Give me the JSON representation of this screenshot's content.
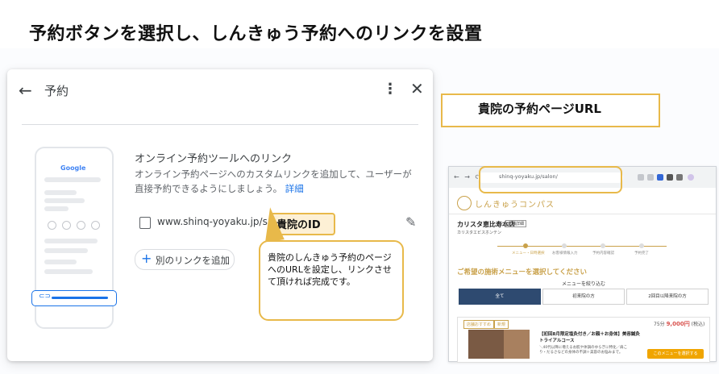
{
  "slide": {
    "title": "予約ボタンを選択し、しんきゅう予約へのリンクを設置"
  },
  "dialog": {
    "title": "予約",
    "back_icon": "arrow-back-icon",
    "more_icon": "more-vert-icon",
    "close_icon": "close-icon",
    "heading": "オンライン予約ツールへのリンク",
    "description": "オンライン予約ページへのカスタムリンクを追加して、ユーザーが直接予約できるようにしましょう。",
    "details_link": "詳細",
    "url": "www.shinq-yoyaku.jp/salon/",
    "id_label": "貴院のID",
    "add_link_label": "別のリンクを追加",
    "phone_logo": "Google"
  },
  "callout": {
    "text": "貴院のしんきゅう予約のページへのURLを設定し、リンクさせて頂ければ完成です。"
  },
  "right_label": {
    "text": "貴院の予約ページURL"
  },
  "browser": {
    "address": "shinq-yoyaku.jp/salon/",
    "brand": "しんきゅうコンパス",
    "salon_name": "カリスタ恵比寿本店",
    "salon_kana": "カリスタエビスホンテン",
    "badge": "店舗詳細",
    "steps": [
      "メニュー・日時選択",
      "お客様情報入力",
      "予約内容確認",
      "予約完了"
    ],
    "section_title": "ご希望の施術メニューを選択してください",
    "filter_label": "メニューを絞り込む",
    "tabs": [
      "全て",
      "初来院の方",
      "2回目以降来院の方"
    ],
    "tags": [
      "店舗おすすめ",
      "新規"
    ],
    "course_title": "【初回8月限定塩灸付き／お顔＋お身体】美容鍼灸トライアルコース",
    "course_desc": "＼40代以降に増えるお肌や体調のゆらぎに特化／肩こり・だるさなどの身体の不調＋美容のお悩みまで。",
    "duration": "75分",
    "price": "9,000円",
    "tax": "(税込)",
    "cta": "このメニューを選択する"
  },
  "colors": {
    "accent": "#e8b94a",
    "link": "#1a73e8",
    "brand_gold": "#c9a14a"
  }
}
